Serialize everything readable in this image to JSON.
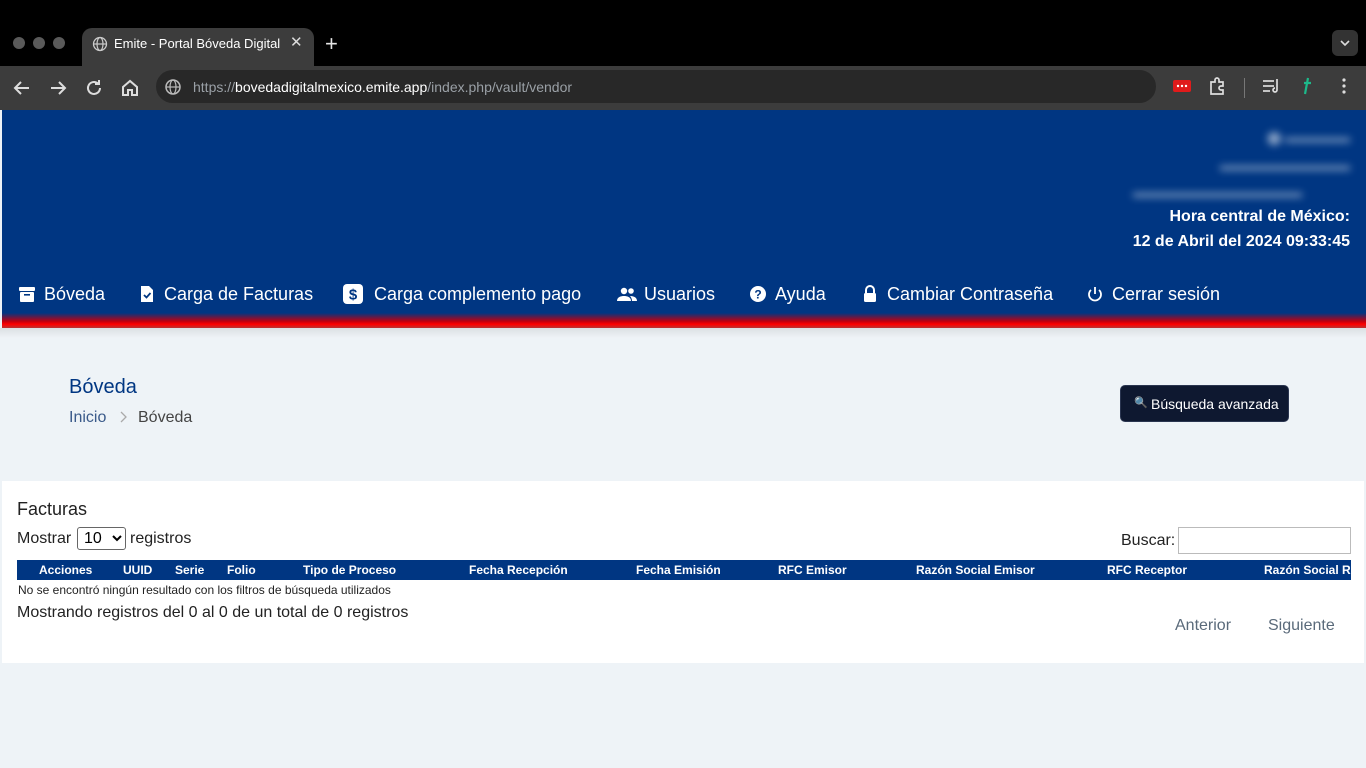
{
  "browser": {
    "tab_title": "Emite - Portal Bóveda Digital México",
    "url_host": "bovedadigitalmexico.emite.app",
    "url_prefix": "https://",
    "url_path": "/index.php/vault/vendor"
  },
  "header": {
    "clock_label": "Hora central de México:",
    "clock_value": "12 de Abril del 2024 09:33:45"
  },
  "nav": {
    "items": [
      {
        "label": "Bóveda",
        "icon": "archive-icon"
      },
      {
        "label": "Carga de Facturas",
        "icon": "file-check-icon"
      },
      {
        "label": "Carga complemento pago",
        "icon": "dollar-icon"
      },
      {
        "label": "Usuarios",
        "icon": "users-icon"
      },
      {
        "label": "Ayuda",
        "icon": "help-icon"
      },
      {
        "label": "Cambiar Contraseña",
        "icon": "lock-icon"
      },
      {
        "label": "Cerrar sesión",
        "icon": "power-icon"
      }
    ]
  },
  "page": {
    "title": "Bóveda",
    "breadcrumb_home": "Inicio",
    "breadcrumb_current": "Bóveda",
    "advanced_search": "Búsqueda avanzada"
  },
  "table": {
    "title": "Facturas",
    "show_label": "Mostrar",
    "show_value": "10",
    "records_label": "registros",
    "search_label": "Buscar:",
    "columns": [
      "Acciones",
      "UUID",
      "Serie",
      "Folio",
      "Tipo de Proceso",
      "Fecha Recepción",
      "Fecha Emisión",
      "RFC Emisor",
      "Razón Social Emisor",
      "RFC Receptor",
      "Razón Social Receptor"
    ],
    "empty_message": "No se encontró ningún resultado con los filtros de búsqueda utilizados",
    "info": "Mostrando registros del 0 al 0 de un total de 0 registros",
    "prev": "Anterior",
    "next": "Siguiente"
  },
  "colors": {
    "brand_blue": "#003682",
    "accent_red": "#ff0000",
    "button_dark": "#0e1830"
  }
}
